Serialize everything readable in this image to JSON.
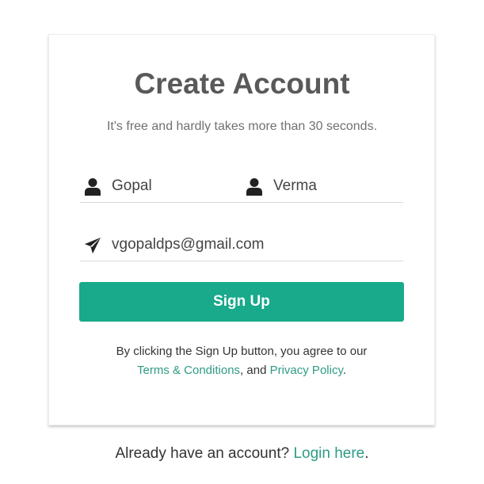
{
  "form": {
    "title": "Create Account",
    "subtitle": "It's free and hardly takes more than 30 seconds.",
    "first_name": {
      "value": "Gopal",
      "icon": "user-icon"
    },
    "last_name": {
      "value": "Verma",
      "icon": "user-icon"
    },
    "email": {
      "value": "vgopaldps@gmail.com",
      "icon": "paper-plane-icon"
    },
    "signup_label": "Sign Up",
    "agree": {
      "prefix": "By clicking the Sign Up button, you agree to our",
      "terms_label": "Terms & Conditions",
      "conjunction": ", and",
      "privacy_label": "Privacy Policy",
      "suffix": "."
    }
  },
  "footer": {
    "text": "Already have an account?",
    "login_label": "Login here",
    "suffix": "."
  },
  "colors": {
    "accent": "#19a98b",
    "link": "#2e9b84",
    "title": "#595959",
    "border": "#d9d9d9"
  }
}
